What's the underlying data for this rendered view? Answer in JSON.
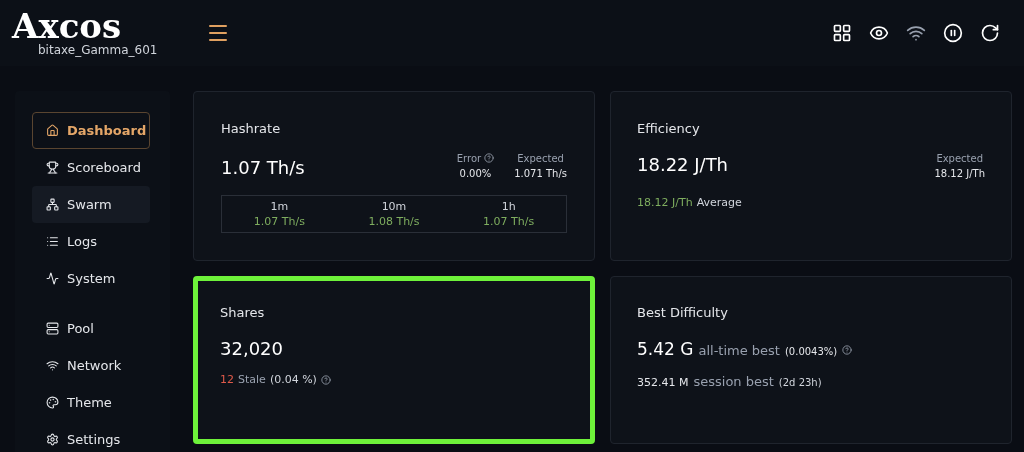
{
  "header": {
    "logo": "Axcos",
    "device": "bitaxe_Gamma_601"
  },
  "sidebar": {
    "sections": [
      {
        "items": [
          {
            "label": "Dashboard",
            "selected": true,
            "hovered": false
          },
          {
            "label": "Scoreboard",
            "selected": false,
            "hovered": false
          },
          {
            "label": "Swarm",
            "selected": false,
            "hovered": true
          },
          {
            "label": "Logs",
            "selected": false,
            "hovered": false
          },
          {
            "label": "System",
            "selected": false,
            "hovered": false
          }
        ]
      },
      {
        "items": [
          {
            "label": "Pool",
            "selected": false,
            "hovered": false
          },
          {
            "label": "Network",
            "selected": false,
            "hovered": false
          },
          {
            "label": "Theme",
            "selected": false,
            "hovered": false
          },
          {
            "label": "Settings",
            "selected": false,
            "hovered": false
          }
        ]
      }
    ]
  },
  "hashrate": {
    "title": "Hashrate",
    "value": "1.07 Th/s",
    "error_label": "Error",
    "error_value": "0.00%",
    "expected_label": "Expected",
    "expected_value": "1.071 Th/s",
    "averages": [
      {
        "period": "1m",
        "value": "1.07 Th/s"
      },
      {
        "period": "10m",
        "value": "1.08 Th/s"
      },
      {
        "period": "1h",
        "value": "1.07 Th/s"
      }
    ]
  },
  "efficiency": {
    "title": "Efficiency",
    "value": "18.22 J/Th",
    "expected_label": "Expected",
    "expected_value": "18.12 J/Th",
    "average_value": "18.12 J/Th",
    "average_label": "Average"
  },
  "shares": {
    "title": "Shares",
    "value": "32,020",
    "highlighted": true,
    "stale_count": "12",
    "stale_label": "Stale",
    "stale_percent": "(0.04 %)"
  },
  "best_difficulty": {
    "title": "Best Difficulty",
    "alltime_value": "5.42 G",
    "alltime_label": "all-time best",
    "alltime_percent": "(0.0043%)",
    "session_value": "352.41 M",
    "session_label": "session best",
    "session_age": "(2d 23h)"
  }
}
